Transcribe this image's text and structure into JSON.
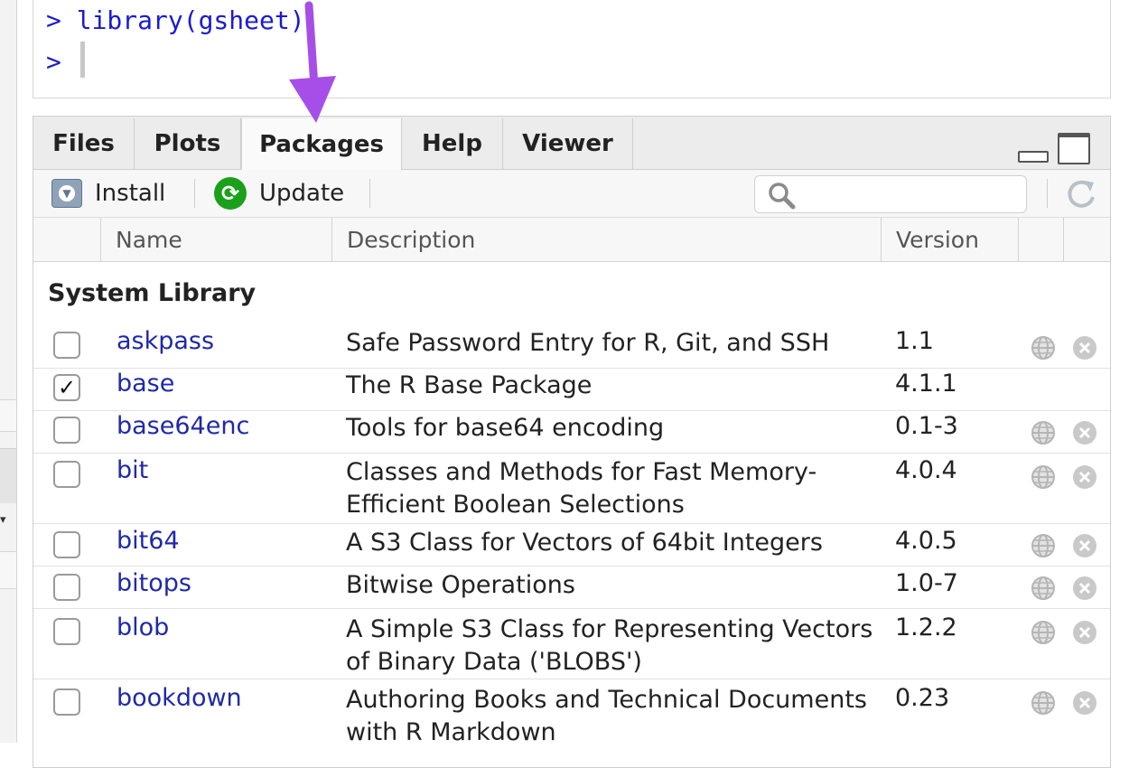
{
  "console": {
    "line1": "> library(gsheet)",
    "line2": ">"
  },
  "tabs": [
    {
      "label": "Files",
      "active": false
    },
    {
      "label": "Plots",
      "active": false
    },
    {
      "label": "Packages",
      "active": true
    },
    {
      "label": "Help",
      "active": false
    },
    {
      "label": "Viewer",
      "active": false
    }
  ],
  "toolbar": {
    "install_label": "Install",
    "update_label": "Update",
    "search_placeholder": ""
  },
  "columns": {
    "name": "Name",
    "description": "Description",
    "version": "Version"
  },
  "section_title": "System Library",
  "packages": [
    {
      "name": "askpass",
      "description": "Safe Password Entry for R, Git, and SSH",
      "version": "1.1",
      "checked": false,
      "removable": true
    },
    {
      "name": "base",
      "description": "The R Base Package",
      "version": "4.1.1",
      "checked": true,
      "removable": false
    },
    {
      "name": "base64enc",
      "description": "Tools for base64 encoding",
      "version": "0.1-3",
      "checked": false,
      "removable": true
    },
    {
      "name": "bit",
      "description": "Classes and Methods for Fast Memory-Efficient Boolean Selections",
      "version": "4.0.4",
      "checked": false,
      "removable": true
    },
    {
      "name": "bit64",
      "description": "A S3 Class for Vectors of 64bit Integers",
      "version": "4.0.5",
      "checked": false,
      "removable": true
    },
    {
      "name": "bitops",
      "description": "Bitwise Operations",
      "version": "1.0-7",
      "checked": false,
      "removable": true
    },
    {
      "name": "blob",
      "description": "A Simple S3 Class for Representing Vectors of Binary Data ('BLOBS')",
      "version": "1.2.2",
      "checked": false,
      "removable": true
    },
    {
      "name": "bookdown",
      "description": "Authoring Books and Technical Documents with R Markdown",
      "version": "0.23",
      "checked": false,
      "removable": true
    }
  ],
  "icons": {
    "install": "install-icon",
    "update": "update-icon",
    "search": "search-icon",
    "refresh": "refresh-icon",
    "globe": "globe-icon",
    "remove": "remove-icon",
    "minimize": "minimize-icon",
    "maximize": "maximize-icon",
    "annotation_arrow": "arrow-annotation"
  },
  "colors": {
    "accent_arrow": "#a64fe8",
    "console_text": "#1a1ad4",
    "package_link": "#1f29a8",
    "update_green": "#1aa01a"
  }
}
